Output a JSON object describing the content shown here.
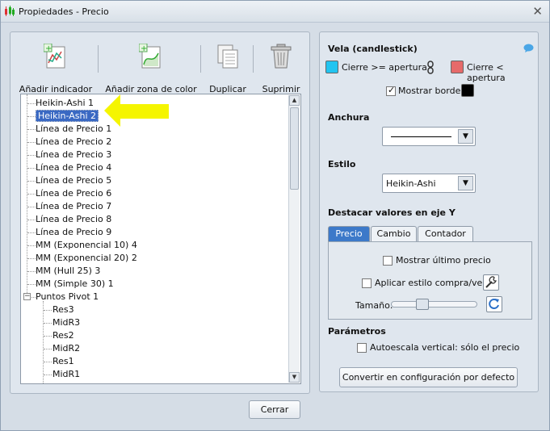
{
  "window": {
    "title": "Propiedades - Precio"
  },
  "toolbar": {
    "add_indicator": "Añadir indicador",
    "add_color_zone": "Añadir zona de color",
    "duplicate": "Duplicar",
    "delete": "Suprimir"
  },
  "tree": {
    "items": [
      "Heikin-Ashi 1",
      "Heikin-Ashi 2",
      "Línea de Precio 1",
      "Línea de Precio 2",
      "Línea de Precio 3",
      "Línea de Precio 4",
      "Línea de Precio 5",
      "Línea de Precio 6",
      "Línea de Precio 7",
      "Línea de Precio 8",
      "Línea de Precio 9",
      "MM (Exponencial 10) 4",
      "MM (Exponencial 20) 2",
      "MM (Hull 25) 3",
      "MM (Simple 30) 1",
      "Puntos Pivot 1"
    ],
    "pivot_children": [
      "Res3",
      "MidR3",
      "Res2",
      "MidR2",
      "Res1",
      "MidR1"
    ],
    "expander_symbol": "−"
  },
  "close_button": "Cerrar",
  "props": {
    "section_candle": "Vela (candlestick)",
    "close_up_label": "Cierre >= apertura",
    "close_down_label": "Cierre < apertura",
    "show_borders_label": "Mostrar bordes",
    "width_title": "Anchura",
    "style_title": "Estilo",
    "style_value": "Heikin-Ashi",
    "highlight_title": "Destacar valores en eje Y",
    "tabs": [
      "Precio",
      "Cambio",
      "Contador"
    ],
    "show_last_price": "Mostrar último precio",
    "apply_buy_sell": "Aplicar estilo compra/venta",
    "size_label": "Tamaño:",
    "params_title": "Parámetros",
    "autoscale_label": "Autoescala vertical: sólo el precio",
    "convert_default": "Convertir en configuración por defecto"
  },
  "colors": {
    "up": "#22c4f0",
    "down": "#e66a6a",
    "border": "#000000",
    "highlight_arrow": "#f5f500",
    "selection": "#3a69c3"
  },
  "state": {
    "selected_item": "Heikin-Ashi 2",
    "show_borders_checked": true,
    "show_last_price_checked": false,
    "apply_buy_sell_checked": false,
    "autoscale_checked": false,
    "active_tab": "Precio",
    "size_slider_fraction": 0.33
  }
}
